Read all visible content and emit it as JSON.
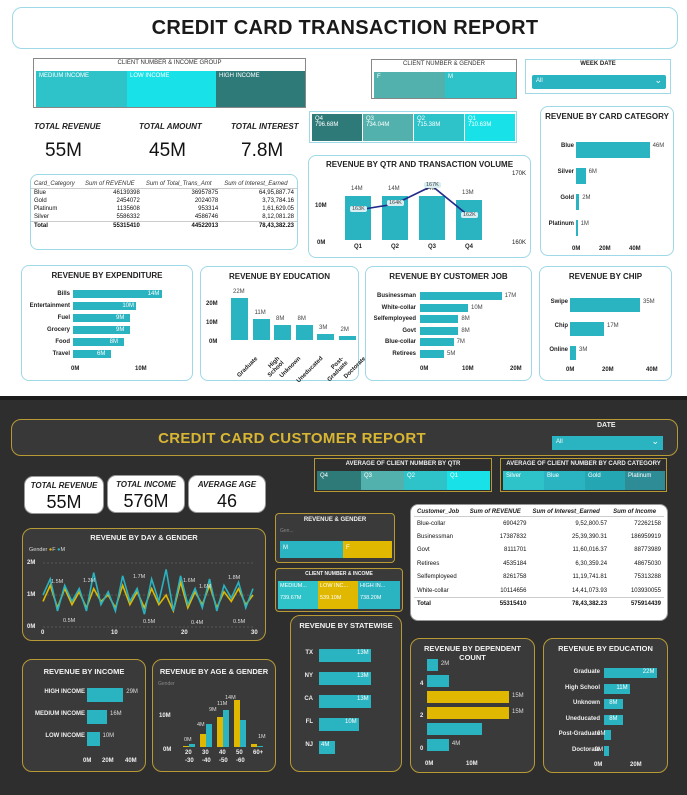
{
  "report1": {
    "title": "CREDIT CARD TRANSACTION REPORT",
    "income_slicer": {
      "label": "CLIENT NUMBER & INCOME GROUP",
      "items": [
        "MEDIUM INCOME",
        "LOW INCOME",
        "HIGH INCOME"
      ]
    },
    "gender_slicer": {
      "label": "CLIENT NUMBER & GENDER",
      "items": [
        "F",
        "M"
      ]
    },
    "week_slicer": {
      "label": "WEEK DATE",
      "value": "All"
    },
    "quarter_slicer": {
      "items": [
        {
          "q": "Q4",
          "v": "796.68M"
        },
        {
          "q": "Q3",
          "v": "734.04M"
        },
        {
          "q": "Q2",
          "v": "715.38M"
        },
        {
          "q": "Q1",
          "v": "710.63M"
        }
      ]
    },
    "kpis": [
      {
        "label": "TOTAL REVENUE",
        "value": "55M"
      },
      {
        "label": "TOTAL AMOUNT",
        "value": "45M"
      },
      {
        "label": "TOTAL INTEREST",
        "value": "7.8M"
      }
    ],
    "table": {
      "headers": [
        "Card_Category",
        "Sum of REVENUE",
        "Sum of Total_Trans_Amt",
        "Sum of Interest_Earned"
      ],
      "rows": [
        [
          "Blue",
          "46139398",
          "36957875",
          "64,95,887.74"
        ],
        [
          "Gold",
          "2454072",
          "2024078",
          "3,73,784.16"
        ],
        [
          "Platinum",
          "1135608",
          "953314",
          "1,61,629.05"
        ],
        [
          "Silver",
          "5586332",
          "4586746",
          "8,12,081.28"
        ]
      ],
      "total": [
        "Total",
        "55315410",
        "44522013",
        "78,43,382.23"
      ]
    },
    "qtr_chart": {
      "title": "REVENUE BY QTR AND TRANSACTION VOLUME",
      "y_ticks": [
        "10M",
        "0M"
      ],
      "y2_ticks": [
        "170K",
        "160K"
      ],
      "categories": [
        "Q1",
        "Q2",
        "Q3",
        "Q4"
      ],
      "bar_labels": [
        "14M",
        "14M",
        "14M",
        "13M"
      ],
      "line_labels": [
        "163K",
        "164K",
        "167K",
        "162K"
      ]
    },
    "card_cat_chart": {
      "title": "REVENUE BY CARD CATEGORY",
      "x_ticks": [
        "0M",
        "20M",
        "40M"
      ]
    },
    "expenditure_chart": {
      "title": "REVENUE BY EXPENDITURE",
      "x_ticks": [
        "0M",
        "10M"
      ]
    },
    "education_chart": {
      "title": "REVENUE BY EDUCATION",
      "y_ticks": [
        "20M",
        "10M",
        "0M"
      ]
    },
    "job_chart": {
      "title": "REVENUE BY CUSTOMER JOB",
      "x_ticks": [
        "0M",
        "10M",
        "20M"
      ]
    },
    "chip_chart": {
      "title": "REVENUE BY CHIP",
      "x_ticks": [
        "0M",
        "20M",
        "40M"
      ]
    }
  },
  "report2": {
    "title": "CREDIT CARD CUSTOMER REPORT",
    "date_slicer": {
      "label": "DATE",
      "value": "All"
    },
    "kpis": [
      {
        "label": "TOTAL REVENUE",
        "value": "55M"
      },
      {
        "label": "TOTAL INCOME",
        "value": "576M"
      },
      {
        "label": "AVERAGE AGE",
        "value": "46"
      }
    ],
    "qtr_slicer": {
      "label": "AVERAGE OF CLIENT NUMBER BY QTR",
      "items": [
        "Q4",
        "Q3",
        "Q2",
        "Q1"
      ]
    },
    "cat_slicer": {
      "label": "AVERAGE OF CLIENT NUMBER BY CARD CATEGORY",
      "items": [
        "Silver",
        "Blue",
        "Gold",
        "Platinum"
      ]
    },
    "rev_gender": {
      "title": "REVENUE & GENDER",
      "legend": "Gen...",
      "items": [
        "M",
        "F"
      ]
    },
    "client_income": {
      "title": "CLIENT NUMBER & INCOME",
      "items": [
        {
          "n": "MEDIUM...",
          "v": "739.67M"
        },
        {
          "n": "LOW INC...",
          "v": "539.10M"
        },
        {
          "n": "HIGH IN...",
          "v": "738.20M"
        }
      ]
    },
    "day_chart": {
      "title": "REVENUE BY DAY & GENDER",
      "legend_title": "Gender",
      "legend": [
        "F",
        "M"
      ],
      "y_ticks": [
        "2M",
        "1M",
        "0M"
      ],
      "x_ticks": [
        "0",
        "10",
        "20",
        "30"
      ],
      "labels": [
        "1.5M",
        "1.3M",
        "1.7M",
        "1.6M",
        "1.8M",
        "1.6M",
        "0.5M",
        "0.5M",
        "0.4M",
        "0.5M"
      ]
    },
    "table": {
      "headers": [
        "Customer_Job",
        "Sum of REVENUE",
        "Sum of Interest_Earned",
        "Sum of Income"
      ],
      "rows": [
        [
          "Blue-collar",
          "6904279",
          "9,52,800.57",
          "72262158"
        ],
        [
          "Businessman",
          "17387832",
          "25,39,390.31",
          "186959919"
        ],
        [
          "Govt",
          "8111701",
          "11,60,016.37",
          "88773989"
        ],
        [
          "Retirees",
          "4535184",
          "6,30,359.24",
          "48675030"
        ],
        [
          "Selfemployeed",
          "8261758",
          "11,19,741.81",
          "75313288"
        ],
        [
          "White-collar",
          "10114656",
          "14,41,073.93",
          "103930055"
        ]
      ],
      "total": [
        "Total",
        "55315410",
        "78,43,382.23",
        "575914439"
      ]
    },
    "income_chart": {
      "title": "REVENUE BY INCOME",
      "x_ticks": [
        "0M",
        "20M",
        "40M"
      ]
    },
    "age_chart": {
      "title": "REVENUE BY AGE & GENDER",
      "legend": "Gender",
      "y_ticks": [
        "10M",
        "0M"
      ],
      "x_ticks": [
        "20",
        "30",
        "40",
        "50",
        "60+"
      ],
      "x_ticks2": [
        "-30",
        "-40",
        "-50",
        "-60"
      ],
      "labels": [
        "14M",
        "11M",
        "9M",
        "4M",
        "0M",
        "1M"
      ]
    },
    "state_chart": {
      "title": "REVENUE BY STATEWISE"
    },
    "dependent_chart": {
      "title": "REVENUE BY DEPENDENT COUNT",
      "y_ticks": [
        "4",
        "2",
        "0"
      ],
      "x_ticks": [
        "0M",
        "10M"
      ]
    },
    "education_chart": {
      "title": "REVENUE BY EDUCATION",
      "x_ticks": [
        "0M",
        "20M"
      ]
    }
  },
  "chart_data": [
    {
      "type": "bar",
      "title": "REVENUE BY QTR AND TRANSACTION VOLUME",
      "categories": [
        "Q1",
        "Q2",
        "Q3",
        "Q4"
      ],
      "series": [
        {
          "name": "Revenue",
          "values": [
            14,
            14,
            14,
            13
          ]
        },
        {
          "name": "Transaction Volume",
          "values": [
            163,
            164,
            167,
            162
          ]
        }
      ]
    },
    {
      "type": "bar",
      "title": "REVENUE BY CARD CATEGORY",
      "categories": [
        "Blue",
        "Silver",
        "Gold",
        "Platinum"
      ],
      "values": [
        46,
        6,
        2,
        1
      ],
      "labels": [
        "46M",
        "6M",
        "2M",
        "1M"
      ],
      "xlim": [
        0,
        50
      ]
    },
    {
      "type": "bar",
      "title": "REVENUE BY EXPENDITURE",
      "categories": [
        "Bills",
        "Entertainment",
        "Fuel",
        "Grocery",
        "Food",
        "Travel"
      ],
      "values": [
        14,
        10,
        9,
        9,
        8,
        6
      ],
      "labels": [
        "14M",
        "10M",
        "9M",
        "9M",
        "8M",
        "6M"
      ],
      "xlim": [
        0,
        15
      ]
    },
    {
      "type": "bar",
      "title": "REVENUE BY EDUCATION",
      "categories": [
        "Graduate",
        "High School",
        "Unknown",
        "Uneducated",
        "Post-Graduate",
        "Doctorate"
      ],
      "values": [
        22,
        11,
        8,
        8,
        3,
        2
      ],
      "labels": [
        "22M",
        "11M",
        "8M",
        "8M",
        "3M",
        "2M"
      ],
      "ylim": [
        0,
        25
      ]
    },
    {
      "type": "bar",
      "title": "REVENUE BY CUSTOMER JOB",
      "categories": [
        "Businessman",
        "White-collar",
        "Selfemployeed",
        "Govt",
        "Blue-collar",
        "Retirees"
      ],
      "values": [
        17,
        10,
        8,
        8,
        7,
        5
      ],
      "labels": [
        "17M",
        "10M",
        "8M",
        "8M",
        "7M",
        "5M"
      ],
      "xlim": [
        0,
        20
      ]
    },
    {
      "type": "bar",
      "title": "REVENUE BY CHIP",
      "categories": [
        "Swipe",
        "Chip",
        "Online"
      ],
      "values": [
        35,
        17,
        3
      ],
      "labels": [
        "35M",
        "17M",
        "3M"
      ],
      "xlim": [
        0,
        40
      ]
    },
    {
      "type": "line",
      "title": "REVENUE BY DAY & GENDER",
      "x": [
        1,
        2,
        3,
        4,
        5,
        6,
        7,
        8,
        9,
        10,
        11,
        12,
        13,
        14,
        15,
        16,
        17,
        18,
        19,
        20,
        21,
        22,
        23,
        24,
        25,
        26,
        27,
        28,
        29,
        30
      ],
      "series": [
        {
          "name": "F",
          "values": [
            0.8,
            1.3,
            0.6,
            1.2,
            0.7,
            1.1,
            0.6,
            1.2,
            0.8,
            1.0,
            0.6,
            1.3,
            0.7,
            1.1,
            0.6,
            1.2,
            0.7,
            1.0,
            0.5,
            1.4,
            0.6,
            1.1,
            0.7,
            1.3,
            0.6,
            1.1,
            0.8,
            1.2,
            0.7,
            1.0
          ]
        },
        {
          "name": "M",
          "values": [
            1.0,
            1.5,
            0.5,
            1.3,
            0.8,
            1.2,
            0.5,
            1.7,
            0.7,
            1.1,
            0.5,
            1.6,
            0.8,
            1.2,
            0.4,
            1.5,
            0.8,
            1.8,
            0.5,
            1.6,
            0.7,
            1.2,
            0.6,
            1.5,
            0.5,
            1.3,
            0.9,
            1.4,
            0.6,
            1.2
          ]
        }
      ],
      "ylim": [
        0,
        2
      ]
    },
    {
      "type": "bar",
      "title": "REVENUE BY INCOME",
      "categories": [
        "HIGH INCOME",
        "MEDIUM INCOME",
        "LOW INCOME"
      ],
      "values": [
        29,
        16,
        10
      ],
      "labels": [
        "29M",
        "16M",
        "10M"
      ],
      "xlim": [
        0,
        40
      ]
    },
    {
      "type": "bar",
      "title": "REVENUE BY AGE & GENDER",
      "categories": [
        "20-30",
        "30-40",
        "40-50",
        "50-60",
        "60+"
      ],
      "series": [
        {
          "name": "F",
          "values": [
            0,
            4,
            9,
            14,
            1
          ]
        },
        {
          "name": "M",
          "values": [
            1,
            7,
            11,
            8,
            0
          ]
        }
      ],
      "ylim": [
        0,
        15
      ]
    },
    {
      "type": "bar",
      "title": "REVENUE BY STATEWISE",
      "categories": [
        "TX",
        "NY",
        "CA",
        "FL",
        "NJ"
      ],
      "values": [
        13,
        13,
        13,
        10,
        4
      ],
      "labels": [
        "13M",
        "13M",
        "13M",
        "10M",
        "4M"
      ]
    },
    {
      "type": "bar",
      "title": "REVENUE BY DEPENDENT COUNT",
      "categories": [
        "5",
        "4",
        "3",
        "2",
        "1",
        "0"
      ],
      "values": [
        2,
        4,
        15,
        15,
        10,
        4
      ],
      "labels": [
        "2M",
        "",
        "15M",
        "15M",
        "",
        "4M"
      ]
    },
    {
      "type": "bar",
      "title": "REVENUE BY EDUCATION",
      "categories": [
        "Graduate",
        "High School",
        "Unknown",
        "Uneducated",
        "Post-Graduate",
        "Doctorate"
      ],
      "values": [
        22,
        11,
        8,
        8,
        3,
        2
      ],
      "labels": [
        "22M",
        "11M",
        "8M",
        "8M",
        "3M",
        "2M"
      ],
      "xlim": [
        0,
        25
      ]
    }
  ]
}
